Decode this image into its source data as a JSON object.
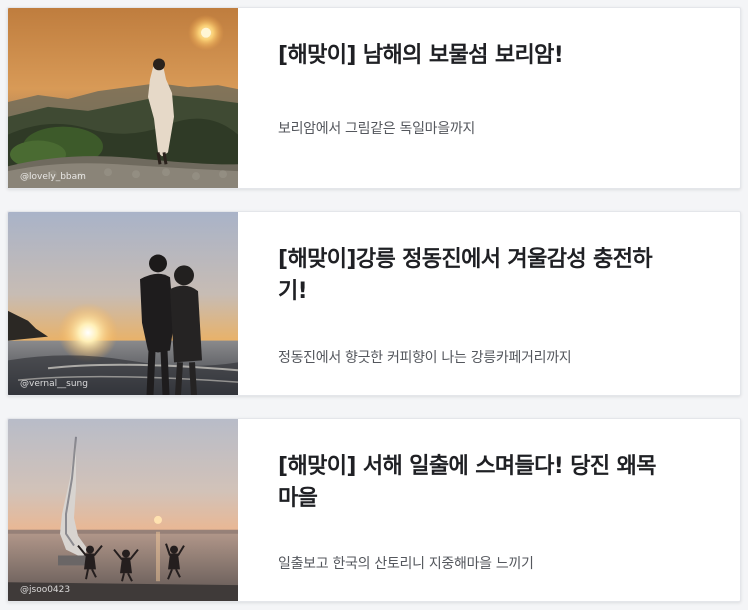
{
  "articles": [
    {
      "title": "[해맞이] 남해의 보물섬 보리암!",
      "description": "보리암에서 그림같은 독일마을까지",
      "photo_credit": "@lovely_bbam"
    },
    {
      "title": "[해맞이]강릉 정동진에서 겨울감성 충전하기!",
      "description": "정동진에서 향긋한 커피향이 나는 강릉카페거리까지",
      "photo_credit": "@vernal__sung"
    },
    {
      "title": "[해맞이] 서해 일출에 스며들다! 당진 왜목마을",
      "description": "일출보고 한국의 산토리니 지중해마을 느끼기",
      "photo_credit": "@jsoo0423"
    }
  ]
}
